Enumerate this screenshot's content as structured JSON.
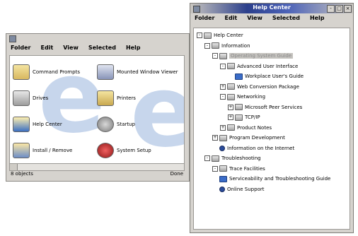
{
  "left_window": {
    "menu": [
      "Folder",
      "Edit",
      "View",
      "Selected",
      "Help"
    ],
    "watermark": "e",
    "items": [
      {
        "label": "Command Prompts",
        "icon": "folder-icon"
      },
      {
        "label": "Mounted Window Viewer",
        "icon": "viewer-icon"
      },
      {
        "label": "Drives",
        "icon": "drive-icon"
      },
      {
        "label": "Printers",
        "icon": "printer-icon"
      },
      {
        "label": "Help Center",
        "icon": "help-icon"
      },
      {
        "label": "Startup",
        "icon": "gear-icon"
      },
      {
        "label": "Install / Remove",
        "icon": "install-icon"
      },
      {
        "label": "System Setup",
        "icon": "setup-icon"
      }
    ],
    "status_left": "8 objects",
    "status_right": "Done"
  },
  "help_window": {
    "title": "Help Center",
    "controls": [
      "-",
      "□",
      "×"
    ],
    "menu": [
      "Folder",
      "Edit",
      "View",
      "Selected",
      "Help"
    ],
    "tree": [
      {
        "label": "Help Center",
        "level": 0,
        "icon": "folder",
        "expander": "-"
      },
      {
        "label": "Information",
        "level": 1,
        "icon": "folder",
        "expander": "-"
      },
      {
        "label": "Operating System Guide",
        "level": 2,
        "icon": "folder",
        "expander": "-",
        "selected": true
      },
      {
        "label": "Advanced User Interface",
        "level": 3,
        "icon": "folder",
        "expander": "-"
      },
      {
        "label": "Workplace User's Guide",
        "level": 4,
        "icon": "doc",
        "expander": ""
      },
      {
        "label": "Web Conversion Package",
        "level": 3,
        "icon": "folder",
        "expander": "+"
      },
      {
        "label": "Networking",
        "level": 3,
        "icon": "folder",
        "expander": "-"
      },
      {
        "label": "Microsoft Peer Services",
        "level": 4,
        "icon": "folder",
        "expander": "+"
      },
      {
        "label": "TCP/IP",
        "level": 4,
        "icon": "folder",
        "expander": "+"
      },
      {
        "label": "Product Notes",
        "level": 3,
        "icon": "folder",
        "expander": "+"
      },
      {
        "label": "Program Development",
        "level": 2,
        "icon": "folder",
        "expander": "+"
      },
      {
        "label": "Information on the Internet",
        "level": 2,
        "icon": "dot",
        "expander": ""
      },
      {
        "label": "Troubleshooting",
        "level": 1,
        "icon": "folder",
        "expander": "-"
      },
      {
        "label": "Trace Facilities",
        "level": 2,
        "icon": "folder",
        "expander": "-"
      },
      {
        "label": "Serviceability and Troubleshooting Guide",
        "level": 2,
        "icon": "doc",
        "expander": ""
      },
      {
        "label": "Online Support",
        "level": 2,
        "icon": "dot",
        "expander": ""
      }
    ]
  }
}
